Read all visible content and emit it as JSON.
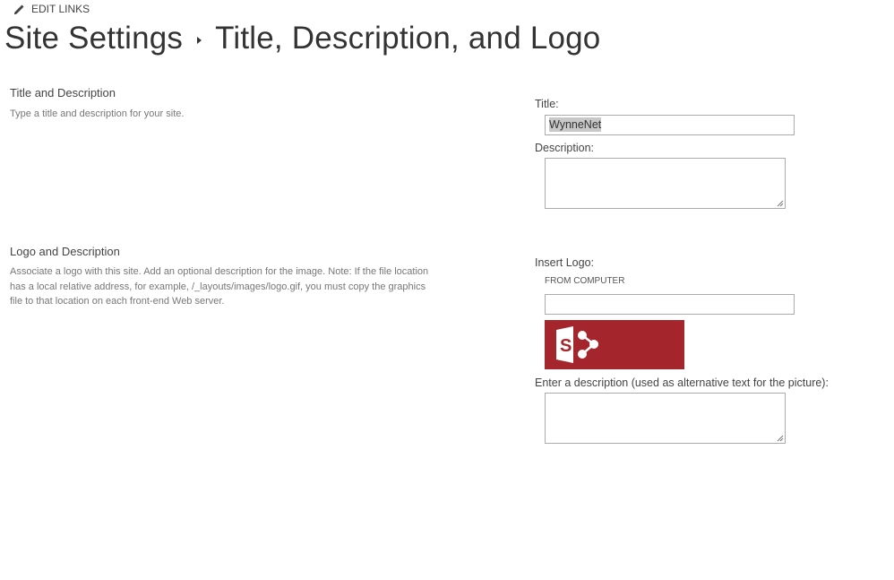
{
  "edit_links": {
    "label": "EDIT LINKS",
    "icon": "pencil-icon"
  },
  "breadcrumb": {
    "parent": "Site Settings",
    "separator_icon": "triangle-right-icon",
    "current": "Title, Description, and Logo"
  },
  "sections": {
    "title_description": {
      "heading": "Title and Description",
      "description": "Type a title and description for your site."
    },
    "logo_description": {
      "heading": "Logo and Description",
      "description": "Associate a logo with this site. Add an optional description for the image. Note: If the file location has a local relative address, for example, /_layouts/images/logo.gif, you must copy the graphics file to that location on each front-end Web server."
    }
  },
  "form": {
    "title_label": "Title:",
    "title_value": "WynneNet",
    "description_label": "Description:",
    "description_value": "",
    "insert_logo_label": "Insert Logo:",
    "from_computer_label": "FROM COMPUTER",
    "logo_url_value": "",
    "logo_preview": {
      "icon": "sharepoint-logo-icon",
      "background_color": "#a4262c"
    },
    "alt_text_label": "Enter a description (used as alternative text for the picture):",
    "alt_text_value": ""
  },
  "colors": {
    "accent_logo": "#a4262c",
    "input_border": "#ababab",
    "selection_highlight": "#c8c8c8"
  }
}
